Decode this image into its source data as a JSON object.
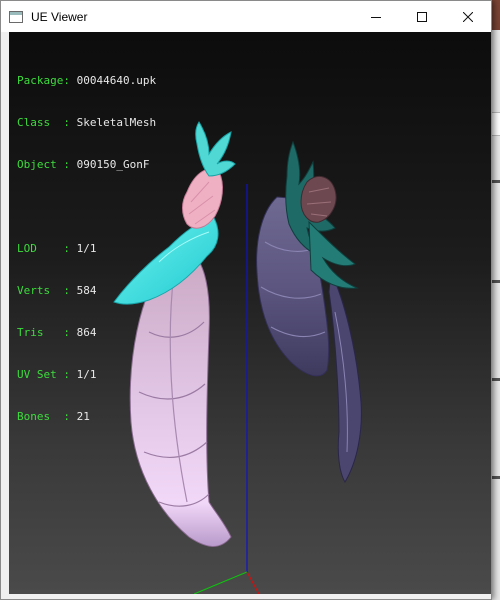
{
  "window": {
    "title": "UE Viewer"
  },
  "info_top": [
    {
      "key": "Package: ",
      "value": "00044640.upk"
    },
    {
      "key": "Class  : ",
      "value": "SkeletalMesh"
    },
    {
      "key": "Object : ",
      "value": "090150_GonF"
    }
  ],
  "info_mesh": [
    {
      "key": "LOD    : ",
      "value": "1/1"
    },
    {
      "key": "Verts  : ",
      "value": "584"
    },
    {
      "key": "Tris   : ",
      "value": "864"
    },
    {
      "key": "UV Set : ",
      "value": "1/1"
    },
    {
      "key": "Bones  : ",
      "value": "21"
    }
  ],
  "colors": {
    "label_green": "#3ddc3d",
    "value_white": "#e8e8e8",
    "axis_blue": "#1010c8",
    "axis_red": "#d01010",
    "axis_green": "#10c010"
  }
}
